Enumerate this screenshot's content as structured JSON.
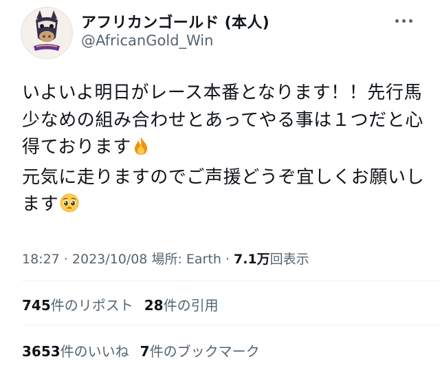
{
  "account": {
    "display_name": "アフリカンゴールド (本人)",
    "handle": "@AfricanGold_Win",
    "avatar_icon": "horse-mascot-icon",
    "more_icon": "more-options-icon"
  },
  "tweet": {
    "line1": "いよいよ明日がレース本番となります！！先行馬",
    "line2": "少なめの組み合わせとあってやる事は１つだと心",
    "line3": "得ております",
    "line4": "元気に走りますのでご声援どうぞ宜しくお願いし",
    "line5": "ます",
    "emoji1": "🔥",
    "emoji2": "🥺"
  },
  "meta": {
    "time": "18:27",
    "sep1": " · ",
    "date": "2023/10/08",
    "location_label": "場所: ",
    "location": "Earth",
    "sep2": " · ",
    "views_count": "7.1万",
    "views_label": "回表示"
  },
  "stats": {
    "reposts_count": "745",
    "reposts_label": "件のリポスト",
    "quotes_count": "28",
    "quotes_label": "件の引用",
    "likes_count": "3653",
    "likes_label": "件のいいね",
    "bookmarks_count": "7",
    "bookmarks_label": "件のブックマーク"
  },
  "colors": {
    "text": "#0f1419",
    "secondary": "#536471",
    "divider": "#eff3f4"
  }
}
